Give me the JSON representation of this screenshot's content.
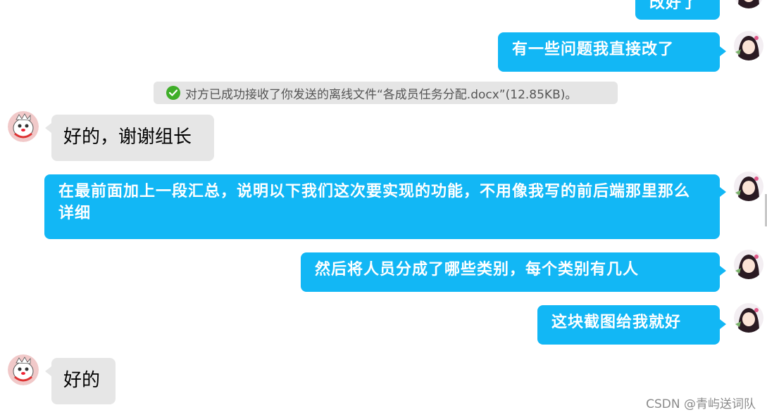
{
  "messages": [
    {
      "side": "me",
      "text": "改好了"
    },
    {
      "side": "me",
      "text": "有一些问题我直接改了"
    },
    {
      "side": "other",
      "text": "好的，谢谢组长"
    },
    {
      "side": "me",
      "text": "在最前面加上一段汇总，说明以下我们这次要实现的功能，不用像我写的前后端那里那么详细"
    },
    {
      "side": "me",
      "text": "然后将人员分成了哪些类别，每个类别有几人"
    },
    {
      "side": "me",
      "text": "这块截图给我就好"
    },
    {
      "side": "other",
      "text": "好的"
    }
  ],
  "system_notice": {
    "icon": "check-circle-icon",
    "text": "对方已成功接收了你发送的离线文件“各成员任务分配.docx”(12.85KB)。"
  },
  "watermark": "CSDN @青屿送词队",
  "colors": {
    "my_bubble": "#12b7f5",
    "other_bubble": "#e6e6e6",
    "notice_bg": "#e5e5e5",
    "check": "#3fae29"
  }
}
